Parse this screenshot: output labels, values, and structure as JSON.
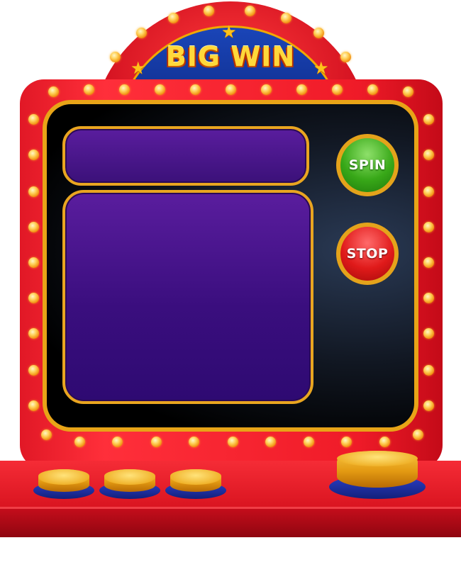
{
  "marquee": {
    "title": "BIG WIN",
    "star_icons": [
      "star-icon",
      "star-icon",
      "star-icon"
    ]
  },
  "controls": {
    "spin_label": "SPIN",
    "stop_label": "STOP",
    "bet_buttons": 3,
    "big_button": 1
  },
  "colors": {
    "cabinet_red": "#e11826",
    "arch_blue": "#1a45b8",
    "gold_trim": "#e8a417",
    "panel_purple": "#5a1d9e",
    "spin_green": "#38a818",
    "stop_red": "#e01a1a",
    "bulb_orange": "#f08a0a",
    "base_button_blue": "#2a3fc8"
  }
}
